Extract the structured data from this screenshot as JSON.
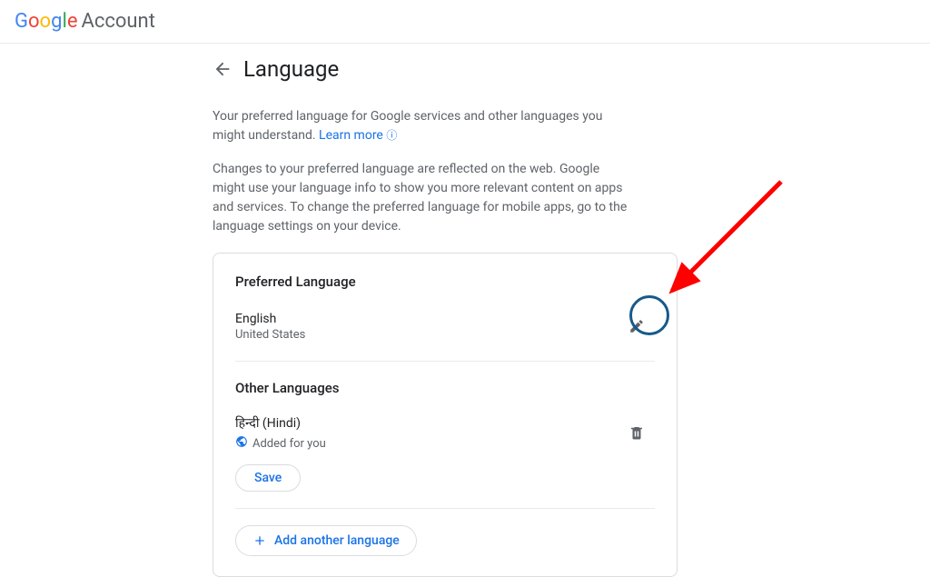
{
  "header": {
    "logo_account": "Account"
  },
  "page": {
    "title": "Language",
    "desc1_prefix": "Your preferred language for Google services and other languages you might understand. ",
    "learn_more": "Learn more",
    "desc2": "Changes to your preferred language are reflected on the web. Google might use your language info to show you more relevant content on apps and services. To change the preferred language for mobile apps, go to the language settings on your device."
  },
  "card": {
    "preferred_title": "Preferred Language",
    "preferred_lang": "English",
    "preferred_region": "United States",
    "other_title": "Other Languages",
    "other_lang": "हिन्दी (Hindi)",
    "added_for_you": "Added for you",
    "save_label": "Save",
    "add_label": "Add another language"
  }
}
